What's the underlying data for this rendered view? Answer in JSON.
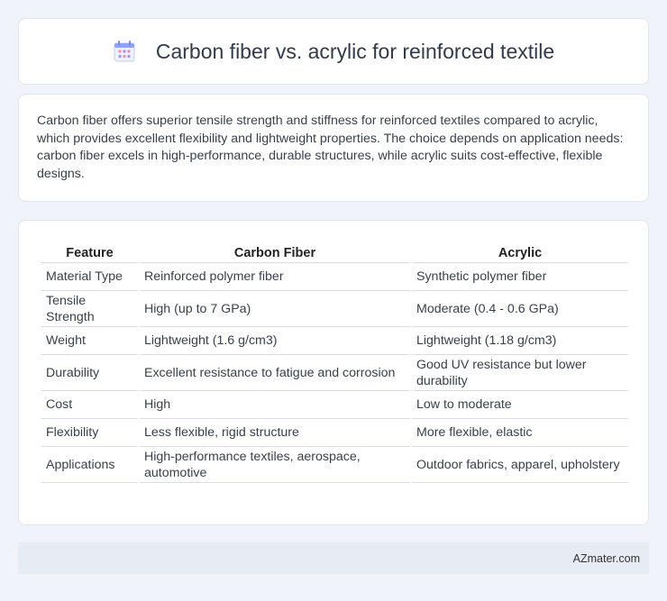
{
  "header": {
    "title": "Carbon fiber vs. acrylic for reinforced textile",
    "icon": "calendar-icon"
  },
  "summary": {
    "text": "Carbon fiber offers superior tensile strength and stiffness for reinforced textiles compared to acrylic, which provides excellent flexibility and lightweight properties. The choice depends on application needs: carbon fiber excels in high-performance, durable structures, while acrylic suits cost-effective, flexible designs."
  },
  "table": {
    "headers": [
      "Feature",
      "Carbon Fiber",
      "Acrylic"
    ],
    "rows": [
      [
        "Material Type",
        "Reinforced polymer fiber",
        "Synthetic polymer fiber"
      ],
      [
        "Tensile Strength",
        "High (up to 7 GPa)",
        "Moderate (0.4 - 0.6 GPa)"
      ],
      [
        "Weight",
        "Lightweight (1.6 g/cm3)",
        "Lightweight (1.18 g/cm3)"
      ],
      [
        "Durability",
        "Excellent resistance to fatigue and corrosion",
        "Good UV resistance but lower durability"
      ],
      [
        "Cost",
        "High",
        "Low to moderate"
      ],
      [
        "Flexibility",
        "Less flexible, rigid structure",
        "More flexible, elastic"
      ],
      [
        "Applications",
        "High-performance textiles, aerospace, automotive",
        "Outdoor fabrics, apparel, upholstery"
      ]
    ]
  },
  "footer": {
    "brand": "AZmater.com"
  },
  "colors": {
    "background": "#f0f3f9",
    "card": "#ffffff",
    "footer": "#e6ebf4",
    "icon_accent": "#8b7fe0"
  }
}
